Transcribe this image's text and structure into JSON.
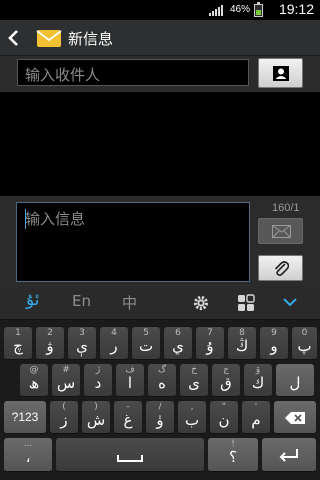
{
  "status_bar": {
    "battery_percent": "46%",
    "time": "19:12",
    "icons": [
      "signal-icon",
      "battery-charging-icon"
    ]
  },
  "header": {
    "title": "新信息",
    "icons": [
      "back-arrow-icon",
      "message-envelope-icon"
    ]
  },
  "recipient": {
    "placeholder": "输入收件人",
    "value": "",
    "contact_icon": "contact-card-icon"
  },
  "compose": {
    "placeholder": "输入信息",
    "value": "",
    "counter": "160/1",
    "send_icon": "send-envelope-icon",
    "attach_icon": "paperclip-icon"
  },
  "keyboard_toolbar": {
    "items": [
      {
        "label": "ئۇ",
        "state": "active"
      },
      {
        "label": "En",
        "state": "normal"
      },
      {
        "label": "中",
        "state": "normal"
      }
    ],
    "icons": [
      "settings-gear-icon",
      "grid-icon",
      "collapse-chevron-icon"
    ],
    "accent_color": "#35a8e5"
  },
  "keyboard": {
    "rows": [
      [
        {
          "main": "چ",
          "sub": "1"
        },
        {
          "main": "ۋ",
          "sub": "2"
        },
        {
          "main": "ې",
          "sub": "3"
        },
        {
          "main": "ر",
          "sub": "4"
        },
        {
          "main": "ت",
          "sub": "5"
        },
        {
          "main": "ي",
          "sub": "6"
        },
        {
          "main": "ۇ",
          "sub": "7"
        },
        {
          "main": "ڭ",
          "sub": "8"
        },
        {
          "main": "و",
          "sub": "9"
        },
        {
          "main": "پ",
          "sub": "0"
        }
      ],
      [
        {
          "main": "ھ",
          "sub": "@"
        },
        {
          "main": "س",
          "sub": "#"
        },
        {
          "main": "د",
          "sub": "ژ"
        },
        {
          "main": "ا",
          "sub": "ف"
        },
        {
          "main": "ە",
          "sub": "گ"
        },
        {
          "main": "ى",
          "sub": "خ"
        },
        {
          "main": "ق",
          "sub": "ج"
        },
        {
          "main": "ك",
          "sub": "ۆ"
        },
        {
          "main": "ل",
          "sub": ""
        }
      ],
      [
        {
          "main": "ز",
          "sub": "("
        },
        {
          "main": "ش",
          "sub": ")"
        },
        {
          "main": "غ",
          "sub": "-"
        },
        {
          "main": "ۈ",
          "sub": "/"
        },
        {
          "main": "ب",
          "sub": ","
        },
        {
          "main": "ن",
          "sub": "\""
        },
        {
          "main": "م",
          "sub": "'"
        }
      ]
    ],
    "func_keys": {
      "numeric": "?123",
      "punct_main": "،",
      "punct_sub": "...",
      "right_main": "؟",
      "right_sub": "!"
    },
    "icons": [
      "backspace-icon",
      "space-bar-icon",
      "enter-icon"
    ]
  }
}
